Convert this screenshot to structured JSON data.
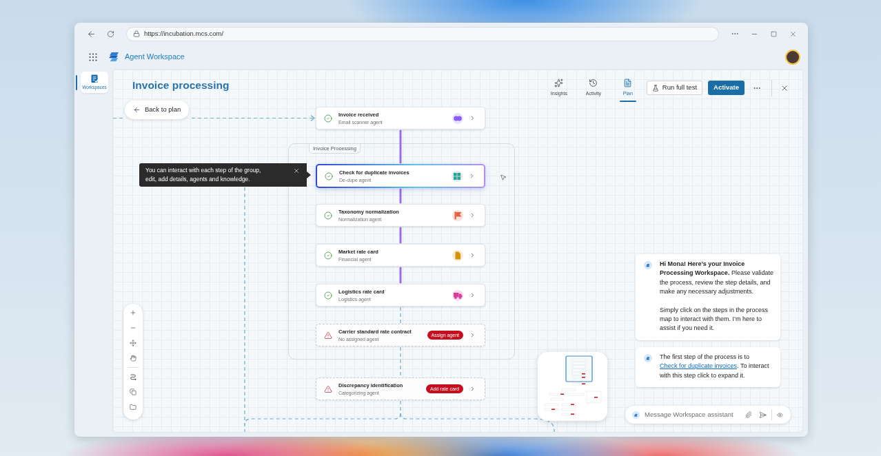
{
  "browser": {
    "url": "https://incubation.mcs.com/"
  },
  "app": {
    "title": "Agent Workspace"
  },
  "sidebar": {
    "items": [
      {
        "label": "Workspaces",
        "selected": true
      }
    ]
  },
  "header": {
    "title": "Invoice processing",
    "tabs": [
      {
        "label": "Insights",
        "selected": false
      },
      {
        "label": "Activity",
        "selected": false
      },
      {
        "label": "Plan",
        "selected": true
      }
    ],
    "actions": [
      {
        "label": "Run full test",
        "kind": "secondary"
      },
      {
        "label": "Activate",
        "kind": "primary"
      }
    ]
  },
  "canvas": {
    "back_button": "Back to plan",
    "tooltip": "You can interact with each step of the group, edit, add details, agents and knowledge.",
    "flow": [
      {
        "kind": "step",
        "title": "Invoice received",
        "subtitle": "Email scanner agent",
        "complete": true,
        "selected": false,
        "color": "#8b5cf6"
      },
      {
        "kind": "group",
        "label": "Invoice Processing",
        "steps": [
          {
            "title": "Check for duplicate invoices",
            "subtitle": "De-dupe agent",
            "complete": true,
            "selected": true,
            "color": "#2f9e94"
          },
          {
            "title": "Taxonomy normalization",
            "subtitle": "Normalization agent",
            "complete": true,
            "selected": false,
            "color": "#e5603f"
          },
          {
            "title": "Market rate card",
            "subtitle": "Financial agent",
            "complete": true,
            "selected": false,
            "color": "#d4940a"
          },
          {
            "title": "Logistics rate card",
            "subtitle": "Logistics agent",
            "complete": true,
            "selected": false,
            "color": "#d63fa0"
          },
          {
            "title": "Carrier standard rate contract",
            "subtitle": "No assigned agent",
            "complete": false,
            "selected": false,
            "badge": "Assign agent"
          }
        ]
      },
      {
        "kind": "step",
        "title": "Discrepancy identification",
        "subtitle": "Categorizing agent",
        "complete": false,
        "selected": false,
        "badge": "Add rate card"
      }
    ]
  },
  "assistant": {
    "messages": [
      {
        "paragraphs": [
          {
            "text": "**Hi Mona! Here’s your Invoice Processing Workspace.** Please validate the process, review the step details, and make any necessary adjustments."
          },
          {
            "text": "Simply click on the steps in the process map to interact with them. I’m here to assist if you need it."
          }
        ]
      },
      {
        "paragraphs": [
          {
            "text": "The first step of the process is to",
            "link": "Check for duplicate invoices",
            "after": ". To interact with this step click to expand it."
          }
        ]
      }
    ],
    "input": {
      "placeholder": "Message Workspace assistant"
    }
  }
}
